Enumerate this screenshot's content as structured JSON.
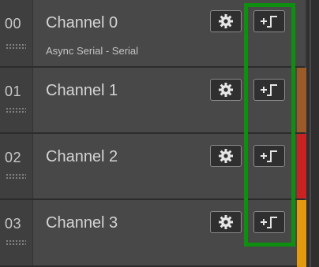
{
  "channels": [
    {
      "index": "00",
      "name": "Channel 0",
      "analyzer": "Async Serial - Serial"
    },
    {
      "index": "01",
      "name": "Channel 1"
    },
    {
      "index": "02",
      "name": "Channel 2"
    },
    {
      "index": "03",
      "name": "Channel 3"
    }
  ],
  "colors": {
    "highlight": "#0f8f0f",
    "channel_1": "#9b5a2a",
    "channel_2": "#c92222",
    "channel_3": "#e39a0e"
  },
  "icons": {
    "settings": "gear-icon",
    "add_trigger": "add-trigger-edge-icon"
  }
}
